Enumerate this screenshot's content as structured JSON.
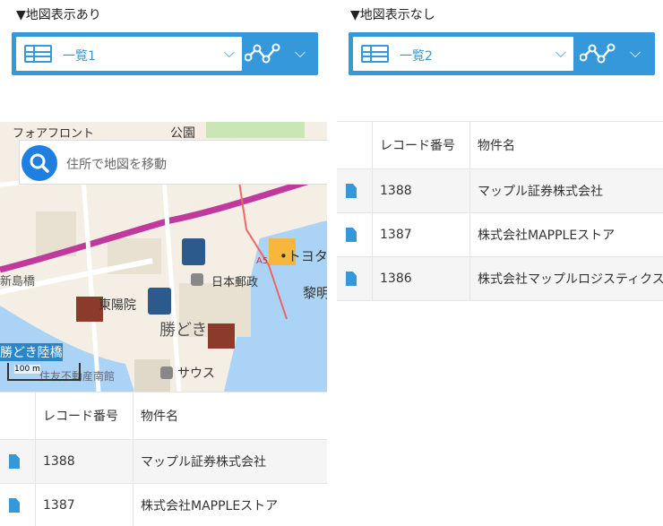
{
  "left": {
    "heading": "▼地図表示あり",
    "view_name": "一覧1",
    "map": {
      "search_placeholder": "住所で地図を移動",
      "labels": {
        "front": "フォアフロント",
        "park": "公園",
        "toyota": "•トヨタ",
        "post": "日本郵政",
        "hospital": "東陽院",
        "kachidoki": "勝どき",
        "bridge": "勝どき陸橋",
        "south": "サウス",
        "realestate": "住友不動産南館",
        "left_bridge": "新島橋",
        "reimei": "黎明",
        "a5": "A5"
      },
      "scale": "100 m"
    },
    "table": {
      "headers": [
        "レコード番号",
        "物件名"
      ],
      "rows": [
        {
          "id": "1388",
          "name": "マップル証券株式会社"
        },
        {
          "id": "1387",
          "name": "株式会社MAPPLEストア"
        }
      ]
    }
  },
  "right": {
    "heading": "▼地図表示なし",
    "view_name": "一覧2",
    "table": {
      "headers": [
        "レコード番号",
        "物件名"
      ],
      "rows": [
        {
          "id": "1388",
          "name": "マップル証券株式会社"
        },
        {
          "id": "1387",
          "name": "株式会社MAPPLEストア"
        },
        {
          "id": "1386",
          "name": "株式会社マップルロジスティクス"
        }
      ]
    }
  },
  "colors": {
    "accent": "#3498db",
    "map_search_button": "#1f7fe0"
  }
}
